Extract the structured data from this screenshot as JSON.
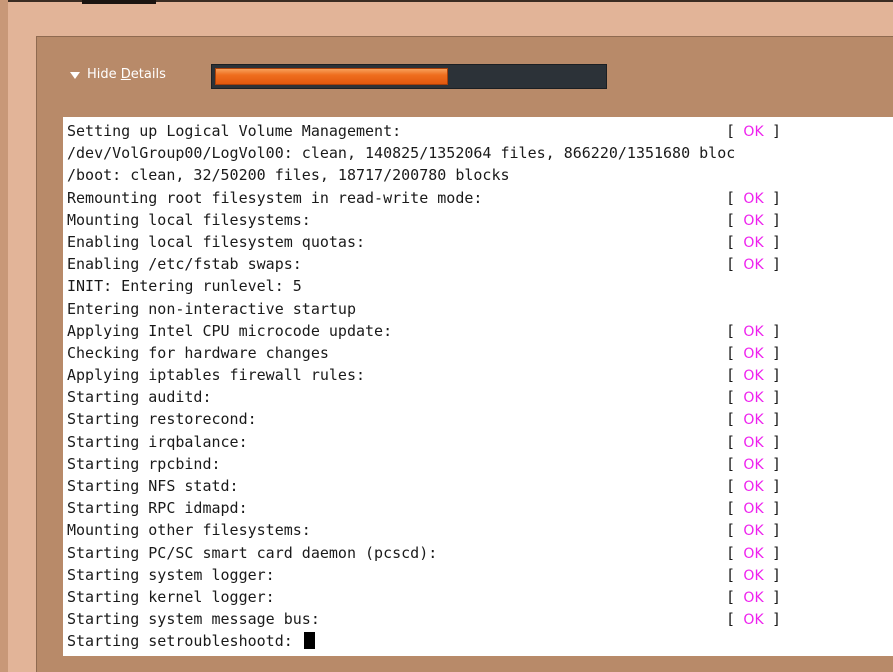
{
  "details": {
    "toggle_prefix": "Hide ",
    "toggle_mnemonic": "D",
    "toggle_suffix": "etails",
    "icon": "triangle-down-icon"
  },
  "progress": {
    "fraction": 0.6
  },
  "colors": {
    "ok": "#ee20ee",
    "progress_fill": "#ef6e1e",
    "progress_track": "#2c3238",
    "panel": "#b88a69",
    "background": "#e2b498"
  },
  "console": {
    "status_ok": "OK",
    "status_open": "[",
    "status_close": "]",
    "lines": [
      {
        "text": "Setting up Logical Volume Management:",
        "ok": true
      },
      {
        "text": "/dev/VolGroup00/LogVol00: clean, 140825/1352064 files, 866220/1351680 bloc",
        "ok": false
      },
      {
        "text": "/boot: clean, 32/50200 files, 18717/200780 blocks",
        "ok": false
      },
      {
        "text": "Remounting root filesystem in read-write mode:",
        "ok": true
      },
      {
        "text": "Mounting local filesystems:",
        "ok": true
      },
      {
        "text": "Enabling local filesystem quotas:",
        "ok": true
      },
      {
        "text": "Enabling /etc/fstab swaps:",
        "ok": true
      },
      {
        "text": "INIT: Entering runlevel: 5",
        "ok": false
      },
      {
        "text": "Entering non-interactive startup",
        "ok": false
      },
      {
        "text": "Applying Intel CPU microcode update:",
        "ok": true
      },
      {
        "text": "Checking for hardware changes",
        "ok": true
      },
      {
        "text": "Applying iptables firewall rules:",
        "ok": true
      },
      {
        "text": "Starting auditd:",
        "ok": true
      },
      {
        "text": "Starting restorecond:",
        "ok": true
      },
      {
        "text": "Starting irqbalance:",
        "ok": true
      },
      {
        "text": "Starting rpcbind:",
        "ok": true
      },
      {
        "text": "Starting NFS statd:",
        "ok": true
      },
      {
        "text": "Starting RPC idmapd:",
        "ok": true
      },
      {
        "text": "Mounting other filesystems:",
        "ok": true
      },
      {
        "text": "Starting PC/SC smart card daemon (pcscd):",
        "ok": true
      },
      {
        "text": "Starting system logger:",
        "ok": true
      },
      {
        "text": "Starting kernel logger:",
        "ok": true
      },
      {
        "text": "Starting system message bus:",
        "ok": true
      },
      {
        "text": "Starting setroubleshootd: ",
        "ok": false,
        "cursor": true
      }
    ]
  }
}
